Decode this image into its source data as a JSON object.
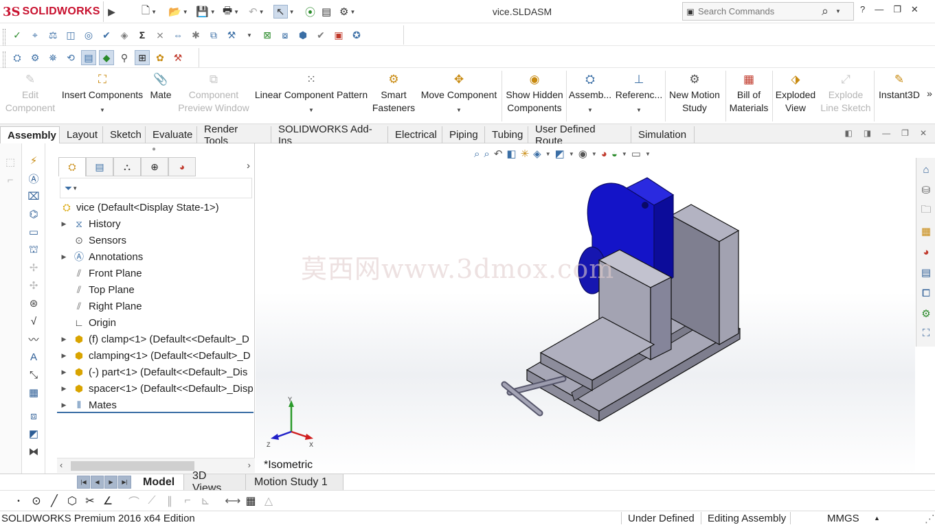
{
  "app": {
    "logo_ds": "3S",
    "logo_name": "SOLIDWORKS",
    "document_title": "vice.SLDASM"
  },
  "search": {
    "placeholder": "Search Commands"
  },
  "window_controls": {
    "help": "?",
    "minimize": "—",
    "restore": "❐",
    "close": "✕"
  },
  "command_manager": {
    "edit_component": [
      "Edit",
      "Component"
    ],
    "insert_components": "Insert Components",
    "mate": "Mate",
    "component_preview": [
      "Component",
      "Preview Window"
    ],
    "linear_pattern": "Linear Component Pattern",
    "smart_fasteners": [
      "Smart",
      "Fasteners"
    ],
    "move_component": "Move Component",
    "show_hidden": [
      "Show Hidden",
      "Components"
    ],
    "assembly_features": "Assemb...",
    "reference_geometry": "Referenc...",
    "new_motion_study": [
      "New Motion",
      "Study"
    ],
    "bill_of_materials": [
      "Bill of",
      "Materials"
    ],
    "exploded_view": [
      "Exploded",
      "View"
    ],
    "explode_line_sketch": [
      "Explode",
      "Line Sketch"
    ],
    "instant3d": "Instant3D",
    "more": "»"
  },
  "tabs": [
    "Assembly",
    "Layout",
    "Sketch",
    "Evaluate",
    "Render Tools",
    "SOLIDWORKS Add-Ins",
    "Electrical",
    "Piping",
    "Tubing",
    "User Defined Route",
    "Simulation"
  ],
  "feature_tree": {
    "root": "vice  (Default<Display State-1>)",
    "items": [
      {
        "label": "History",
        "icon": "history-icon"
      },
      {
        "label": "Sensors",
        "icon": "sensors-icon"
      },
      {
        "label": "Annotations",
        "icon": "annotations-icon"
      },
      {
        "label": "Front Plane",
        "icon": "plane-icon"
      },
      {
        "label": "Top Plane",
        "icon": "plane-icon"
      },
      {
        "label": "Right Plane",
        "icon": "plane-icon"
      },
      {
        "label": "Origin",
        "icon": "origin-icon"
      },
      {
        "label": "(f) clamp<1> (Default<<Default>_D",
        "icon": "part-icon"
      },
      {
        "label": "clamping<1> (Default<<Default>_D",
        "icon": "part-icon"
      },
      {
        "label": "(-) part<1> (Default<<Default>_Dis",
        "icon": "part-icon"
      },
      {
        "label": "spacer<1> (Default<<Default>_Disp",
        "icon": "part-icon"
      },
      {
        "label": "Mates",
        "icon": "mates-icon"
      }
    ]
  },
  "graphics": {
    "watermark": "莫西网www.3dmox.com",
    "view_name": "*Isometric",
    "triad": {
      "x": "X",
      "y": "Y",
      "z": "Z"
    }
  },
  "bottom_tabs": [
    "Model",
    "3D Views",
    "Motion Study 1"
  ],
  "status_bar": {
    "edition": "SOLIDWORKS Premium 2016 x64 Edition",
    "state": "Under Defined",
    "mode": "Editing Assembly",
    "units": "MMGS",
    "units_arrow": "▲"
  },
  "colors": {
    "brand": "#c8102e",
    "accent": "#3a6ea5",
    "clamp_blue": "#1414c8",
    "body_gray": "#a9a9b8"
  }
}
